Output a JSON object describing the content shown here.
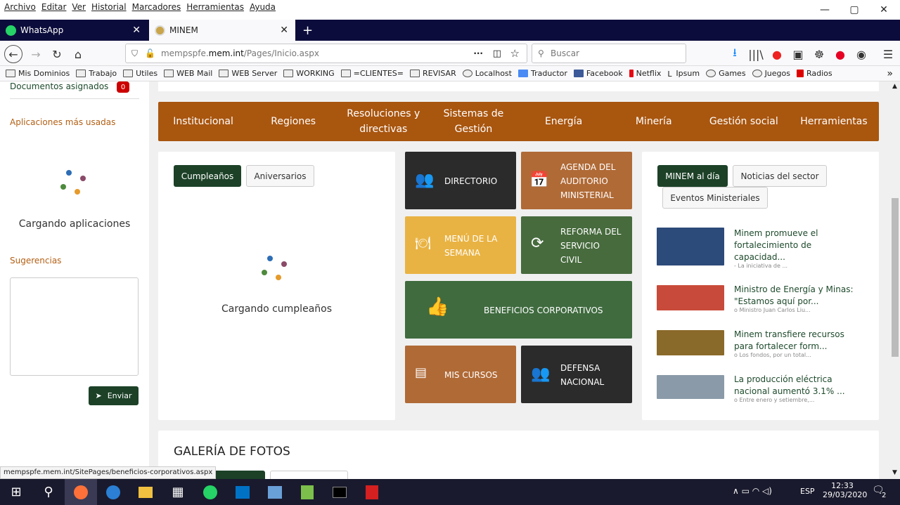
{
  "menubar": [
    "Archivo",
    "Editar",
    "Ver",
    "Historial",
    "Marcadores",
    "Herramientas",
    "Ayuda"
  ],
  "window": {
    "minimize": "—",
    "maximize": "▢",
    "close": "✕"
  },
  "tabs": [
    {
      "label": "WhatsApp",
      "active": false
    },
    {
      "label": "MINEM",
      "active": true
    }
  ],
  "newtab": "+",
  "url": {
    "prefix": "mempspfe.",
    "domain": "mem.int",
    "path": "/Pages/Inicio.aspx"
  },
  "search": {
    "placeholder": "Buscar"
  },
  "bookmarks": [
    "Mis Dominios",
    "Trabajo",
    "Utiles",
    "WEB Mail",
    "WEB Server",
    "WORKING",
    "=CLIENTES=",
    "REVISAR",
    "Localhost",
    "Traductor",
    "Facebook",
    "Netflix",
    "Ipsum",
    "Games",
    "Juegos",
    "Radios"
  ],
  "sidebar": {
    "docs_label": "Documentos asignados",
    "docs_count": "0",
    "apps_title": "Aplicaciones más usadas",
    "apps_loading": "Cargando aplicaciones",
    "suggest_title": "Sugerencias",
    "send": "Enviar"
  },
  "mainnav": [
    [
      "Institucional"
    ],
    [
      "Regiones"
    ],
    [
      "Resoluciones y",
      "directivas"
    ],
    [
      "Sistemas de",
      "Gestión"
    ],
    [
      "Energía"
    ],
    [
      "Minería"
    ],
    [
      "Gestión social"
    ],
    [
      "Herramientas"
    ]
  ],
  "birthdays": {
    "tab1": "Cumpleaños",
    "tab2": "Aniversarios",
    "loading": "Cargando cumpleaños"
  },
  "tiles": {
    "directorio": "DIRECTORIO",
    "agenda": [
      "AGENDA DEL",
      "AUDITORIO",
      "MINISTERIAL"
    ],
    "menu": [
      "MENÚ DE LA",
      "SEMANA"
    ],
    "reforma": [
      "REFORMA DEL",
      "SERVICIO",
      "CIVIL"
    ],
    "beneficios": "BENEFICIOS CORPORATIVOS",
    "cursos": "MIS CURSOS",
    "defensa": [
      "DEFENSA",
      "NACIONAL"
    ]
  },
  "news": {
    "tab1": "MINEM al día",
    "tab2": "Noticias del sector",
    "tab3": "Eventos Ministeriales",
    "items": [
      {
        "title": "Minem promueve el fortalecimiento de capacidad...",
        "snippet": "- La iniciativa de ..."
      },
      {
        "title": "Ministro de Energía y Minas: \"Estamos aquí por...",
        "snippet": "o Ministro Juan Carlos Liu..."
      },
      {
        "title": "Minem transfiere recursos para fortalecer form...",
        "snippet": "o Los fondos, por un total..."
      },
      {
        "title": "La producción eléctrica nacional aumentó 3.1% ...",
        "snippet": "o Entre enero y setiembre,..."
      }
    ]
  },
  "gallery": {
    "title": "GALERÍA DE FOTOS"
  },
  "statusbar": "mempspfe.mem.int/SitePages/beneficios-corporativos.aspx",
  "taskbar": {
    "lang": "ESP",
    "time": "12:33",
    "date": "29/03/2020",
    "notif": "2"
  },
  "colors": {
    "brand_brown": "#a9560f",
    "brand_green": "#1c4127",
    "tile_dark": "#2b2b2b",
    "tile_tan": "#b06a36",
    "tile_yellow": "#e9b343",
    "tile_green": "#476b3d"
  }
}
